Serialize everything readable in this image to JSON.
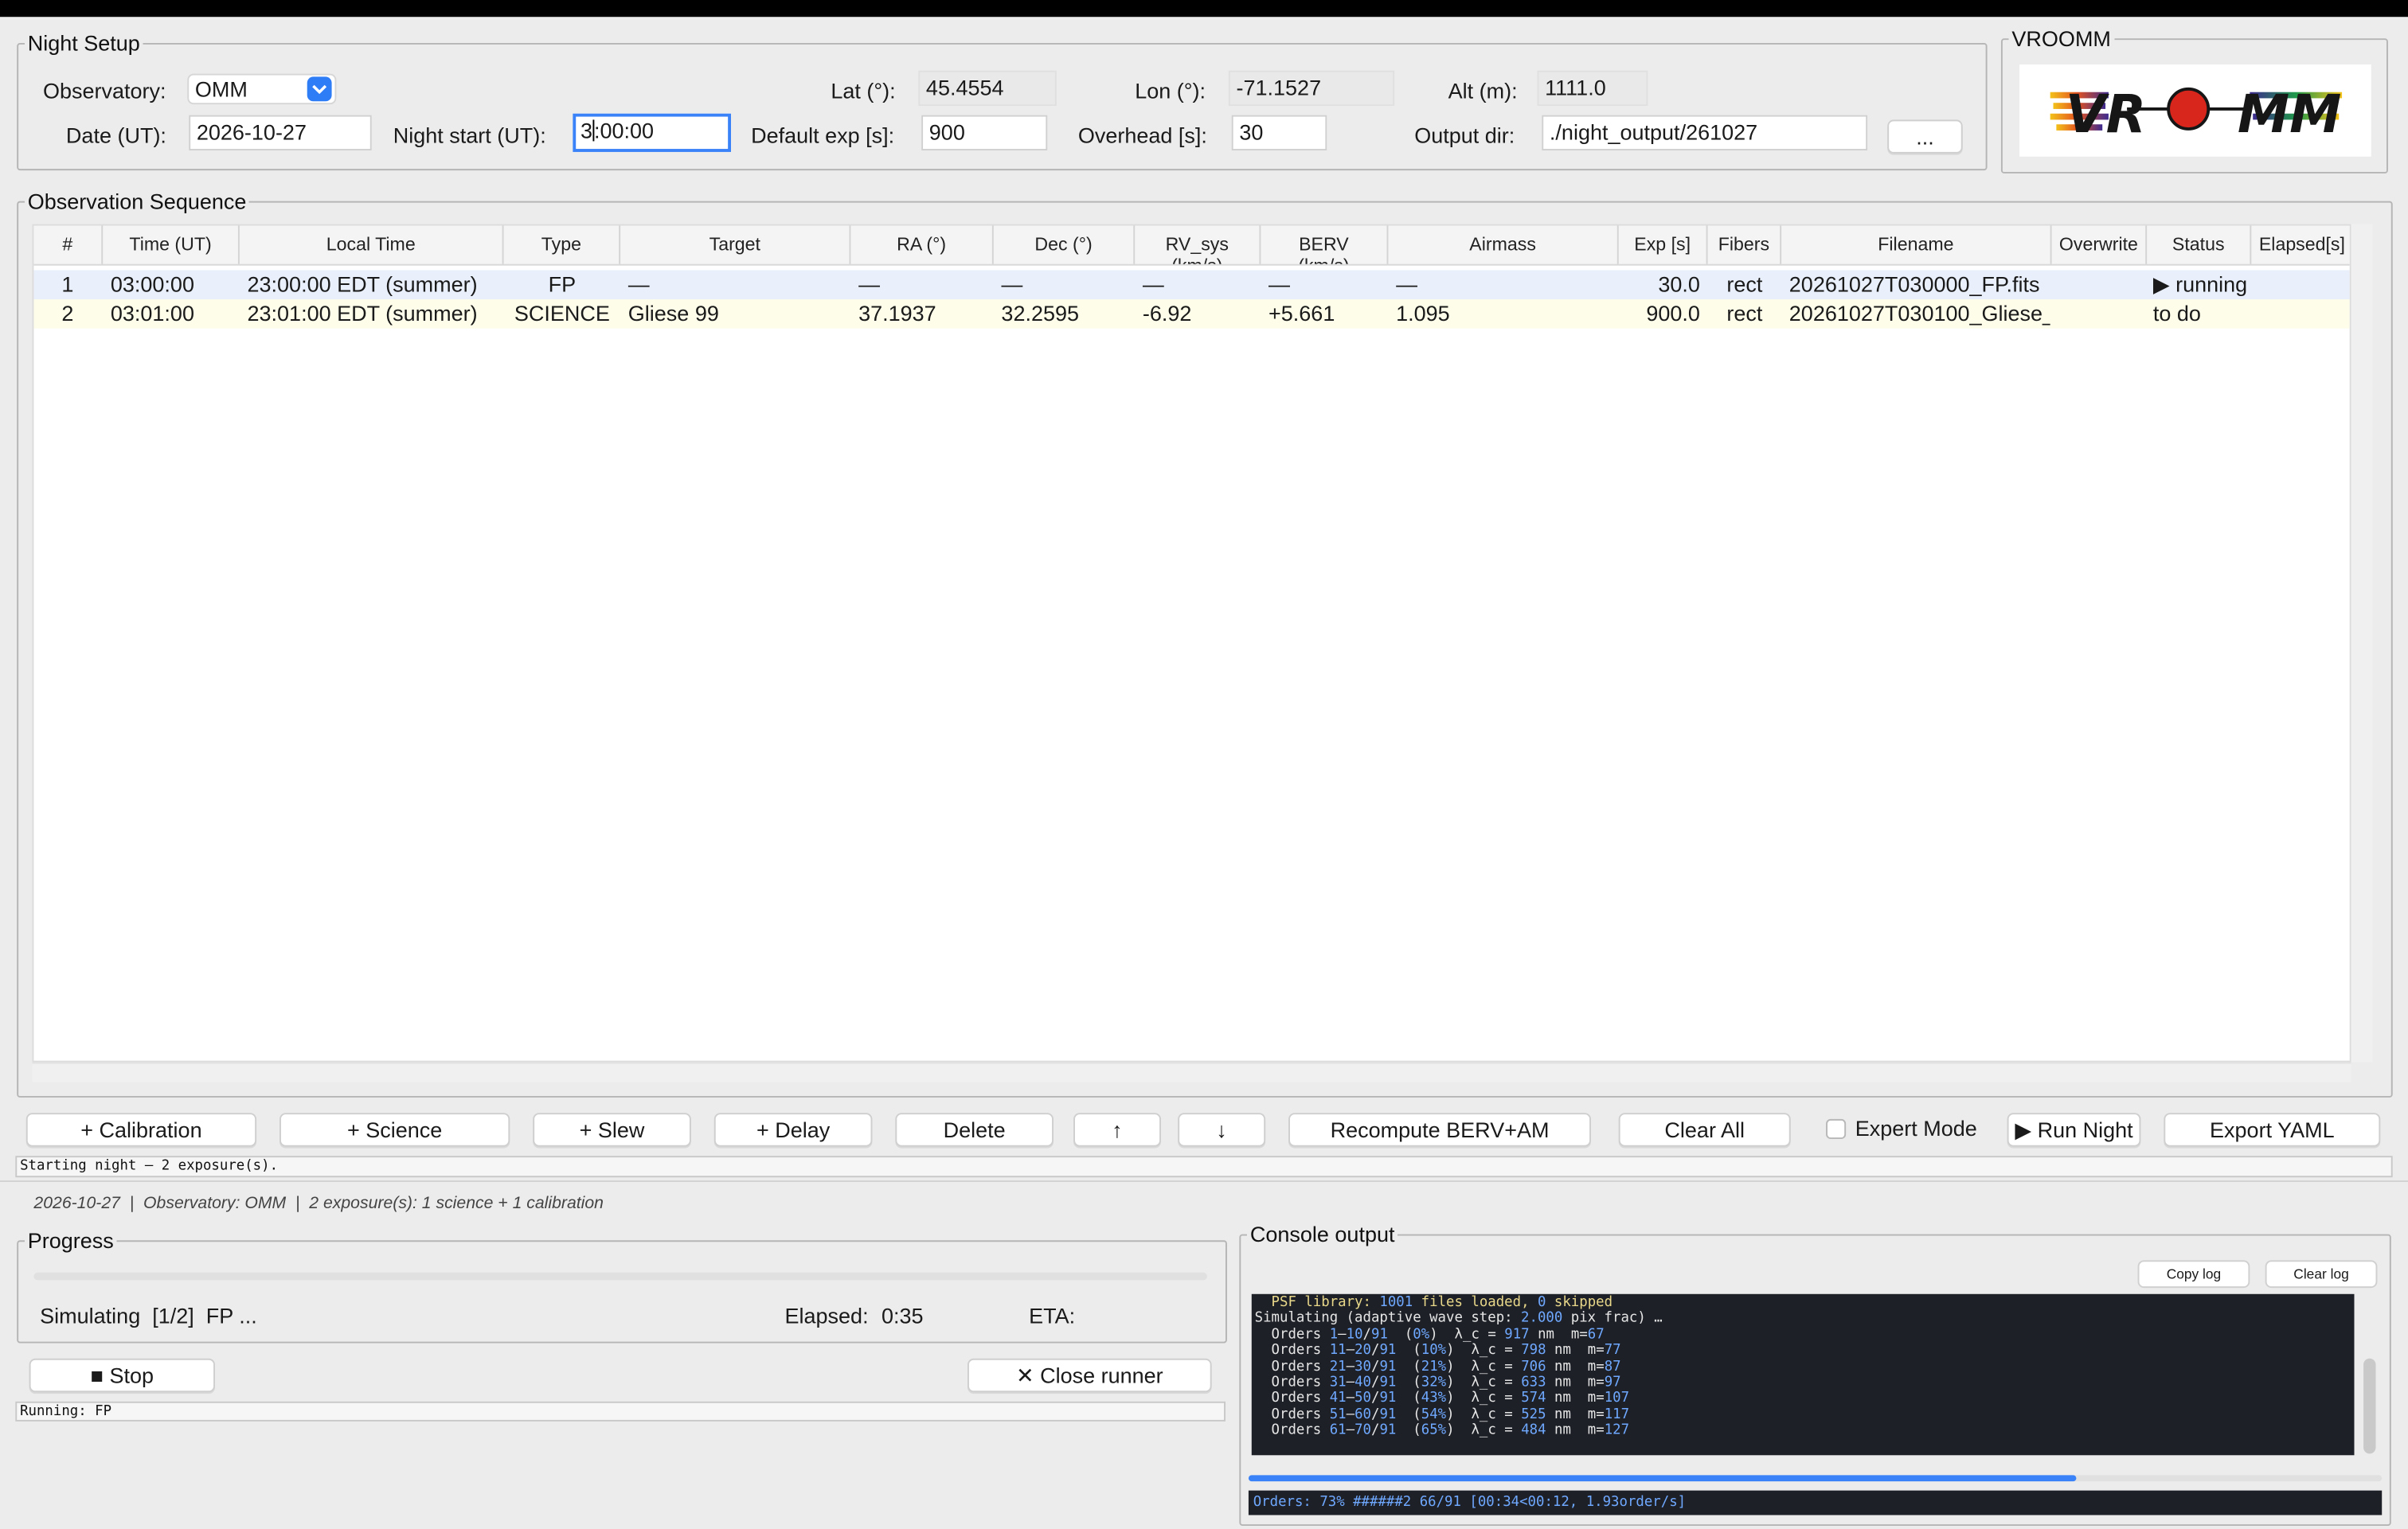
{
  "night_setup": {
    "legend": "Night Setup",
    "observatory_label": "Observatory:",
    "observatory_value": "OMM",
    "lat_label": "Lat (°):",
    "lat_value": "45.4554",
    "lon_label": "Lon (°):",
    "lon_value": "-71.1527",
    "alt_label": "Alt (m):",
    "alt_value": "1111.0",
    "date_label": "Date (UT):",
    "date_value": "2026-10-27",
    "night_start_label": "Night start (UT):",
    "night_start_before_caret": "3",
    "night_start_after_caret": ":00:00",
    "default_exp_label": "Default exp [s]:",
    "default_exp_value": "900",
    "overhead_label": "Overhead [s]:",
    "overhead_value": "30",
    "output_dir_label": "Output dir:",
    "output_dir_value": "./night_output/261027",
    "browse_label": "..."
  },
  "logo": {
    "legend": "VROOMM",
    "text_left": "VR",
    "text_right": "MM"
  },
  "sequence": {
    "legend": "Observation Sequence",
    "columns": [
      "#",
      "Time (UT)",
      "Local Time",
      "Type",
      "Target",
      "RA (°)",
      "Dec (°)",
      "RV_sys (km/s)",
      "BERV (km/s)",
      "Airmass",
      "Exp [s]",
      "Fibers",
      "Filename",
      "Overwrite",
      "Status",
      "Elapsed[s]"
    ],
    "rows": [
      {
        "num": "1",
        "time_ut": "03:00:00",
        "local": "23:00:00 EDT (summer)",
        "type": "FP",
        "target": "—",
        "ra": "—",
        "dec": "—",
        "rv": "—",
        "berv": "—",
        "airmass": "—",
        "exp": "30.0",
        "fibers": "rect",
        "filename": "20261027T030000_FP.fits",
        "overwrite": "",
        "status": "▶ running",
        "elapsed": ""
      },
      {
        "num": "2",
        "time_ut": "03:01:00",
        "local": "23:01:00 EDT (summer)",
        "type": "SCIENCE",
        "target": "Gliese 99",
        "ra": "37.1937",
        "dec": "32.2595",
        "rv": "-6.92",
        "berv": "+5.661",
        "airmass": "1.095",
        "exp": "900.0",
        "fibers": "rect",
        "filename": "20261027T030100_Gliese_",
        "overwrite": "",
        "status": "to do",
        "elapsed": ""
      }
    ]
  },
  "toolbar": {
    "add_calibration": "+ Calibration",
    "add_science": "+ Science",
    "add_slew": "+ Slew",
    "add_delay": "+ Delay",
    "delete": "Delete",
    "move_up": "↑",
    "move_down": "↓",
    "recompute": "Recompute BERV+AM",
    "clear_all": "Clear All",
    "expert_mode": "Expert Mode",
    "run_night": "▶ Run Night",
    "export_yaml": "Export YAML"
  },
  "status_line": "Starting night — 2 exposure(s).",
  "summary_line": "2026-10-27  |  Observatory: OMM  |  2 exposure(s): 1 science + 1 calibration",
  "progress": {
    "legend": "Progress",
    "simulating_text": "Simulating  [1/2]  FP ...",
    "elapsed_label": "Elapsed:",
    "elapsed_value": "0:35",
    "eta_label": "ETA:",
    "eta_value": "",
    "fraction": 0,
    "stop_label": "■  Stop",
    "close_label": "✕ Close runner",
    "running_status": "Running: FP"
  },
  "console": {
    "legend": "Console output",
    "copy_label": "Copy log",
    "clear_label": "Clear log",
    "lines": [
      "  PSF library: 1001 files loaded, 0 skipped",
      "Simulating (adaptive wave step: 2.000 pix frac) …",
      "  Orders 1–10/91  (0%)  λ_c = 917 nm  m=67",
      "  Orders 11–20/91  (10%)  λ_c = 798 nm  m=77",
      "  Orders 21–30/91  (21%)  λ_c = 706 nm  m=87",
      "  Orders 31–40/91  (32%)  λ_c = 633 nm  m=97",
      "  Orders 41–50/91  (43%)  λ_c = 574 nm  m=107",
      "  Orders 51–60/91  (54%)  λ_c = 525 nm  m=117",
      "  Orders 61–70/91  (65%)  λ_c = 484 nm  m=127"
    ],
    "orders_progress_fraction": 0.73,
    "orders_bar_text": "Orders: 73% ######2 66/91 [00:34<00:12, 1.93order/s]"
  },
  "colors": {
    "accent": "#3a82f7",
    "running_row": "#e9f0fb",
    "todo_row": "#fdfdea",
    "console_bg": "#1d2027",
    "console_number": "#6fa8ff"
  }
}
